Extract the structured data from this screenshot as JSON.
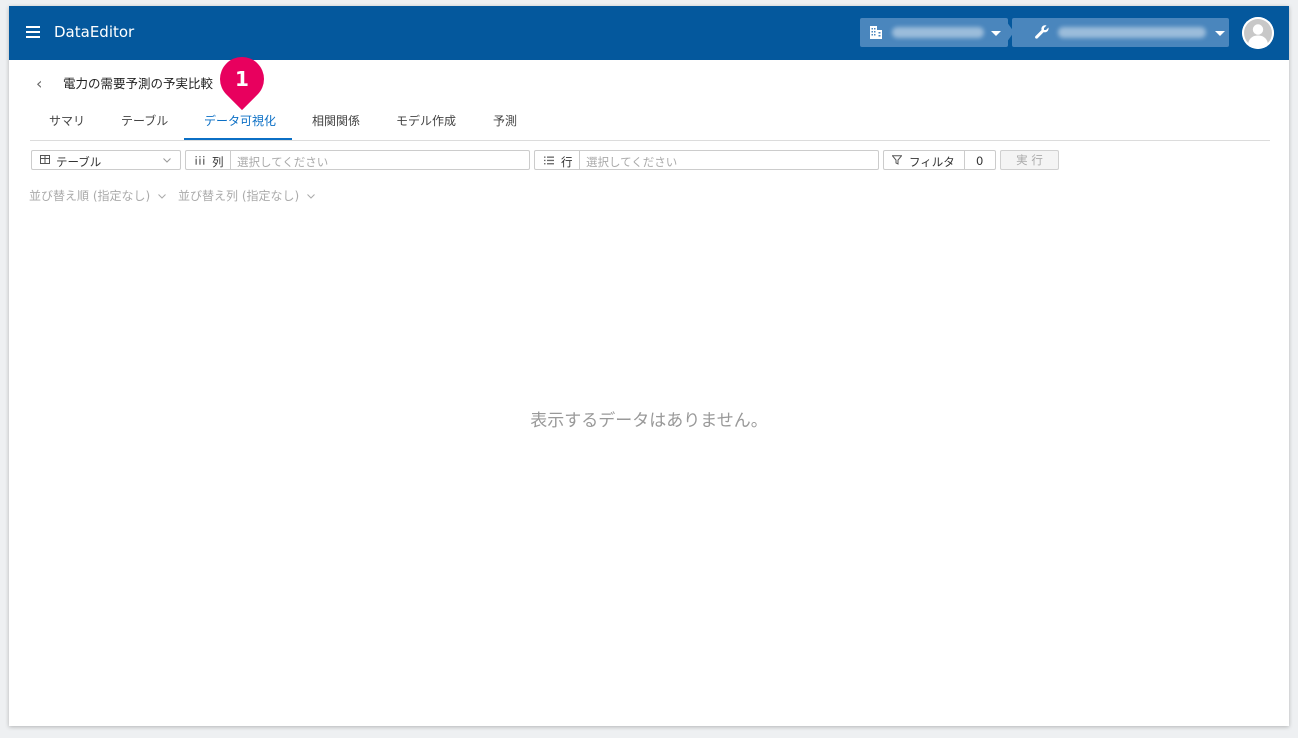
{
  "header": {
    "app_title": "DataEditor",
    "menu_icon": "hamburger-menu-icon",
    "org_icon": "building-icon",
    "project_icon": "wrench-icon",
    "avatar_icon": "user-avatar-icon",
    "bg_color": "#04589d"
  },
  "breadcrumb": {
    "back_glyph": "‹",
    "title": "電力の需要予測の予実比較"
  },
  "badge": {
    "number": "1",
    "color": "#e8005e"
  },
  "tabs": [
    {
      "label": "サマリ"
    },
    {
      "label": "テーブル"
    },
    {
      "label": "データ可視化",
      "active": true
    },
    {
      "label": "相関関係"
    },
    {
      "label": "モデル作成"
    },
    {
      "label": "予測"
    }
  ],
  "toolbar": {
    "view_select": "テーブル",
    "columns_label": "列",
    "columns_placeholder": "選択してください",
    "rows_label": "行",
    "rows_placeholder": "選択してください",
    "filter_label": "フィルタ",
    "filter_count": "0",
    "run_label": "実 行"
  },
  "sort": {
    "order": "並び替え順 (指定なし)",
    "column": "並び替え列 (指定なし)"
  },
  "empty_message": "表示するデータはありません。",
  "colors": {
    "accent": "#0b6fc5"
  }
}
